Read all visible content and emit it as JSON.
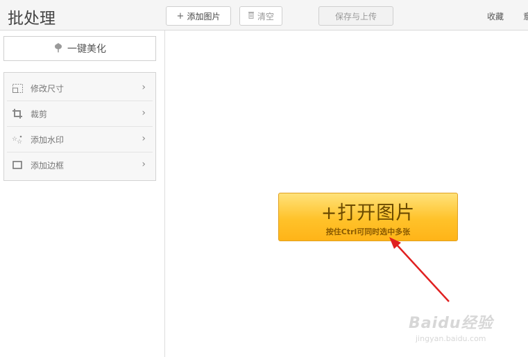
{
  "app": {
    "title": "批处理"
  },
  "toolbar": {
    "add_label": "添加图片",
    "clear_label": "清空",
    "save_label": "保存与上传",
    "favorite_label": "收藏",
    "more_label": "意"
  },
  "sidebar": {
    "beautify_label": "一键美化",
    "items": [
      {
        "label": "修改尺寸",
        "icon": "resize-icon"
      },
      {
        "label": "裁剪",
        "icon": "crop-icon"
      },
      {
        "label": "添加水印",
        "icon": "watermark-icon"
      },
      {
        "label": "添加边框",
        "icon": "border-icon"
      }
    ]
  },
  "main": {
    "open_label": "+打开图片",
    "open_hint": "按住Ctrl可同时选中多张"
  },
  "watermark": {
    "logo_text": "Baidu经验",
    "url": "jingyan.baidu.com"
  },
  "colors": {
    "button_gold": "#ffc22a",
    "arrow_red": "#e02020"
  }
}
